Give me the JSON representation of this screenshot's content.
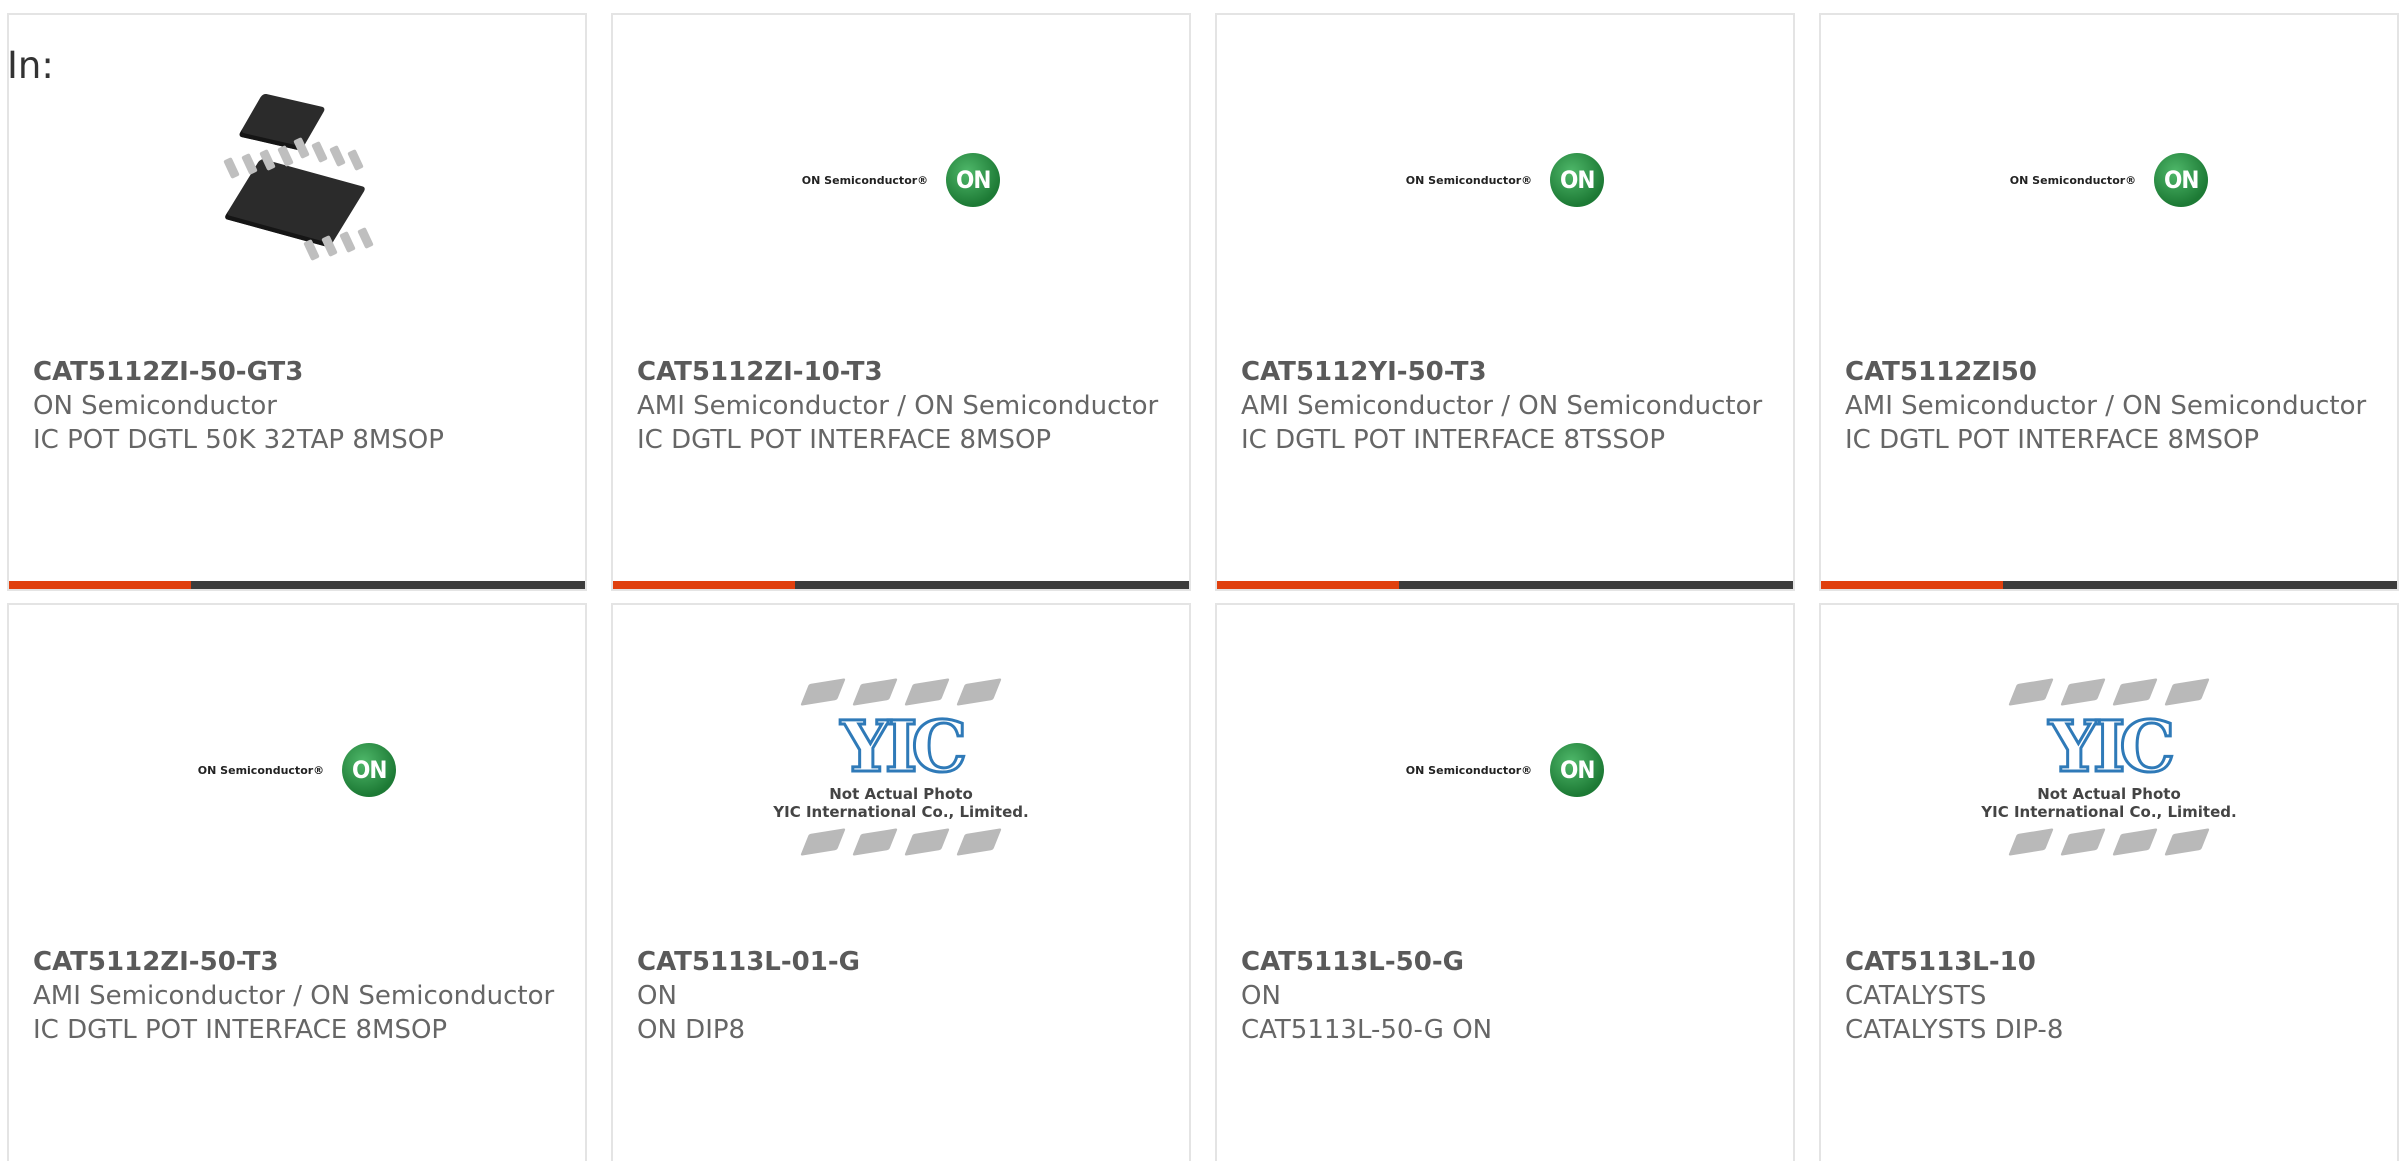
{
  "filter_label": "In:",
  "products": [
    {
      "part": "CAT5112ZI-50-GT3",
      "maker": "ON Semiconductor",
      "desc": "IC POT DGTL 50K 32TAP 8MSOP",
      "image": "chip-package-icon"
    },
    {
      "part": "CAT5112ZI-10-T3",
      "maker": "AMI Semiconductor / ON Semiconductor",
      "desc": "IC DGTL POT INTERFACE 8MSOP",
      "image": "on-semiconductor-logo"
    },
    {
      "part": "CAT5112YI-50-T3",
      "maker": "AMI Semiconductor / ON Semiconductor",
      "desc": "IC DGTL POT INTERFACE 8TSSOP",
      "image": "on-semiconductor-logo"
    },
    {
      "part": "CAT5112ZI50",
      "maker": "AMI Semiconductor / ON Semiconductor",
      "desc": "IC DGTL POT INTERFACE 8MSOP",
      "image": "on-semiconductor-logo"
    },
    {
      "part": "CAT5112ZI-50-T3",
      "maker": "AMI Semiconductor / ON Semiconductor",
      "desc": "IC DGTL POT INTERFACE 8MSOP",
      "image": "on-semiconductor-logo"
    },
    {
      "part": "CAT5113L-01-G",
      "maker": "ON",
      "desc": "ON DIP8",
      "image": "yic-placeholder"
    },
    {
      "part": "CAT5113L-50-G",
      "maker": "ON",
      "desc": "CAT5113L-50-G ON",
      "image": "on-semiconductor-logo"
    },
    {
      "part": "CAT5113L-10",
      "maker": "CATALYSTS",
      "desc": "CATALYSTS DIP-8",
      "image": "yic-placeholder"
    }
  ],
  "logos": {
    "on_text": "ON Semiconductor®",
    "on_mark": "ON",
    "yic_mark": "YIC",
    "yic_caption_1": "Not Actual Photo",
    "yic_caption_2": "YIC International Co., Limited."
  },
  "colors": {
    "accent": "#e0400e",
    "bar": "#3c3c3c",
    "on_green": "#2e9a4c",
    "yic_blue": "#2f7ab8"
  }
}
